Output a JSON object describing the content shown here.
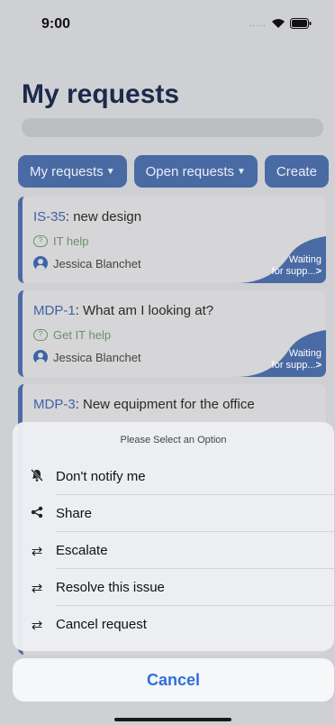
{
  "status": {
    "time": "9:00",
    "signal": "....."
  },
  "page": {
    "title": "My requests"
  },
  "tabs": [
    {
      "label": "My requests"
    },
    {
      "label": "Open requests"
    },
    {
      "label": "Create"
    }
  ],
  "requests": [
    {
      "key": "IS-35",
      "summary": ": new design",
      "type": "IT help",
      "user": "Jessica Blanchet",
      "status_line1": "Waiting",
      "status_line2": "for supp...",
      "status_chevron": ">"
    },
    {
      "key": "MDP-1",
      "summary": ": What am I looking at?",
      "type": "Get IT help",
      "user": "Jessica Blanchet",
      "status_line1": "Waiting",
      "status_line2": "for supp...",
      "status_chevron": ">"
    },
    {
      "key": "MDP-3",
      "summary": ": New equipment for the office"
    }
  ],
  "sheet": {
    "header": "Please Select an Option",
    "options": [
      {
        "label": "Don't notify me",
        "icon": "bell-slash-icon"
      },
      {
        "label": "Share",
        "icon": "share-icon"
      },
      {
        "label": "Escalate",
        "icon": "swap-arrows-icon"
      },
      {
        "label": "Resolve this issue",
        "icon": "swap-arrows-icon"
      },
      {
        "label": "Cancel request",
        "icon": "swap-arrows-icon"
      }
    ],
    "cancel_label": "Cancel"
  },
  "colors": {
    "accent": "#4a6aa3",
    "title": "#1c2a4b",
    "link": "#2e6fe0"
  }
}
